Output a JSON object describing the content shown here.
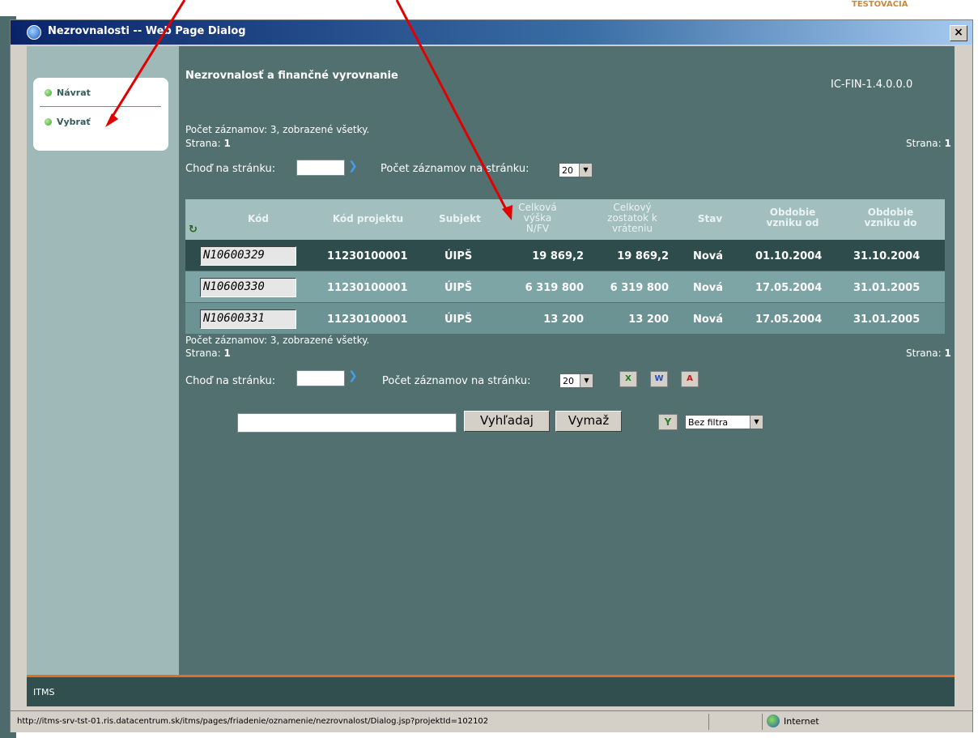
{
  "window": {
    "title": "Nezrovnalosti -- Web Page Dialog",
    "close": "×",
    "background_fragment": "TESTOVACIA"
  },
  "sidebar": {
    "items": [
      {
        "label": "Návrat"
      },
      {
        "label": "Vybrať"
      }
    ]
  },
  "page": {
    "title": "Nezrovnalosť a finančné vyrovnanie",
    "version": "IC-FIN-1.4.0.0.0",
    "top": {
      "count_text": "Počet záznamov: 3, zobrazené všetky.",
      "page_label": "Strana:",
      "page_num": "1",
      "page_right_label": "Strana:",
      "page_right_num": "1",
      "goto_label": "Choď na stránku:",
      "goto_value": "",
      "perpage_label": "Počet záznamov na stránku:",
      "perpage_value": "20"
    },
    "bottom": {
      "count_text": "Počet záznamov: 3, zobrazené všetky.",
      "page_label": "Strana:",
      "page_num": "1",
      "page_right_label": "Strana:",
      "page_right_num": "1",
      "goto_label": "Choď na stránku:",
      "goto_value": "",
      "perpage_label": "Počet záznamov na stránku:",
      "perpage_value": "20"
    }
  },
  "table": {
    "headers": {
      "kod": "Kód",
      "kod_projektu": "Kód projektu",
      "subjekt": "Subjekt",
      "celkova": "Celková výška N/FV",
      "zostatok": "Celkový zostatok k vráteniu",
      "stav": "Stav",
      "obdobie_od": "Obdobie vzniku od",
      "obdobie_do": "Obdobie vzniku do"
    },
    "rows": [
      {
        "kod": "N10600329",
        "kod_projektu": "11230100001",
        "subjekt": "ÚIPŠ",
        "celkova": "19 869,2",
        "zostatok": "19 869,2",
        "stav": "Nová",
        "od": "01.10.2004",
        "do": "31.10.2004",
        "bg": "#2f4c4c"
      },
      {
        "kod": "N10600330",
        "kod_projektu": "11230100001",
        "subjekt": "ÚIPŠ",
        "celkova": "6 319 800",
        "zostatok": "6 319 800",
        "stav": "Nová",
        "od": "17.05.2004",
        "do": "31.01.2005",
        "bg": "#7ea5a5"
      },
      {
        "kod": "N10600331",
        "kod_projektu": "11230100001",
        "subjekt": "ÚIPŠ",
        "celkova": "13 200",
        "zostatok": "13 200",
        "stav": "Nová",
        "od": "17.05.2004",
        "do": "31.01.2005",
        "bg": "#6b9393"
      }
    ]
  },
  "export": {
    "excel": "X",
    "word": "W",
    "pdf": "A"
  },
  "search": {
    "value": "",
    "search_button": "Vyhľadaj",
    "clear_button": "Vymaž",
    "filter_value": "Bez filtra"
  },
  "footer": {
    "text": "ITMS"
  },
  "status": {
    "url": "http://itms-srv-tst-01.ris.datacentrum.sk/itms/pages/friadenie/oznamenie/nezrovnalost/Dialog.jsp?projektId=102102",
    "zone": "Internet"
  },
  "colors": {
    "annotation_arrow": "#e00000"
  }
}
